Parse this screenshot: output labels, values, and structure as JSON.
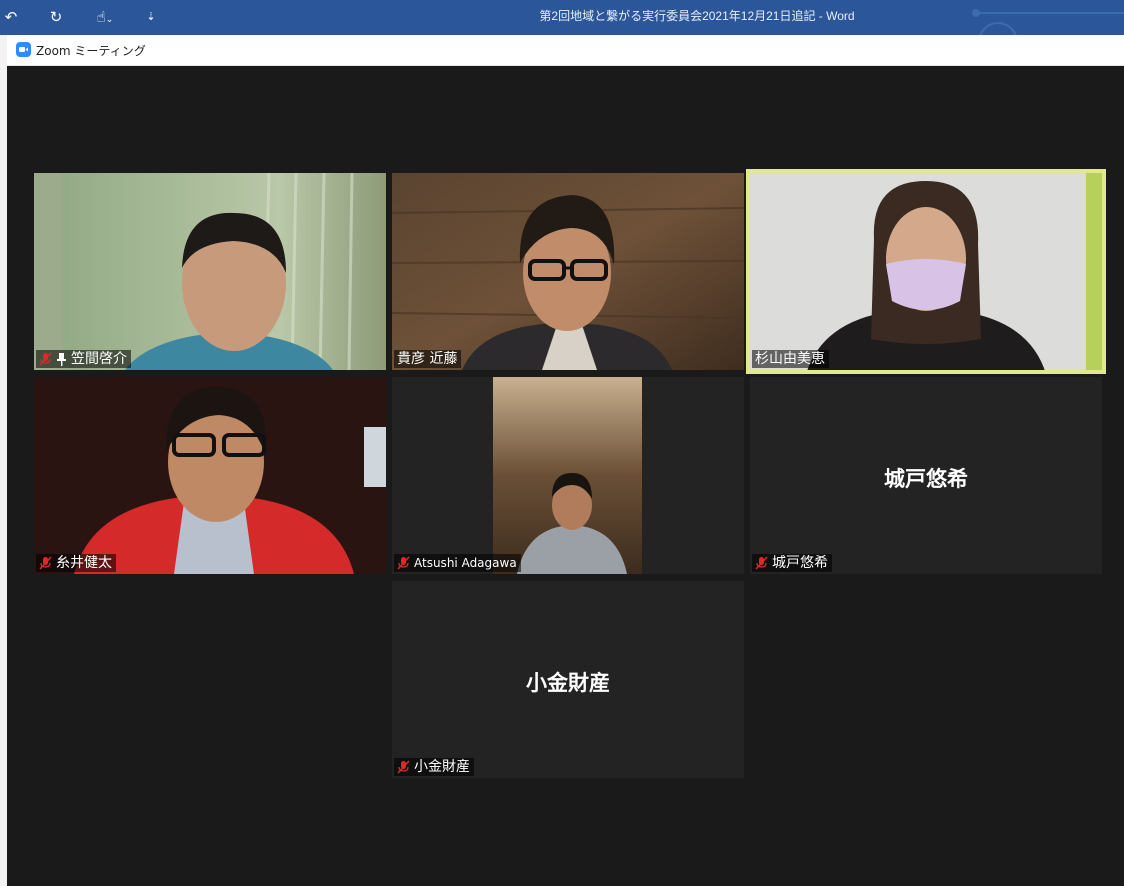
{
  "word": {
    "title": "第2回地域と繋がる実行委員会2021年12月21日追記  -  Word"
  },
  "zoom": {
    "window_title": "Zoom ミーティング"
  },
  "participants": [
    {
      "name": "笠間啓介",
      "muted": true,
      "pinned": true,
      "video": true
    },
    {
      "name": "貴彦 近藤",
      "muted": false,
      "video": true
    },
    {
      "name": "杉山由美恵",
      "muted": false,
      "video": true,
      "active_speaker": true
    },
    {
      "name": "糸井健太",
      "muted": true,
      "video": true
    },
    {
      "name": "Atsushi Adagawa",
      "muted": true,
      "video": true
    },
    {
      "name": "城戸悠希",
      "muted": true,
      "video": false
    },
    {
      "name": "小金財産",
      "muted": true,
      "video": false
    }
  ],
  "colors": {
    "word_bar": "#2b579a",
    "zoom_bg": "#1a1a1a",
    "active_border": "#e2e98a",
    "mute_red": "#e02828"
  }
}
